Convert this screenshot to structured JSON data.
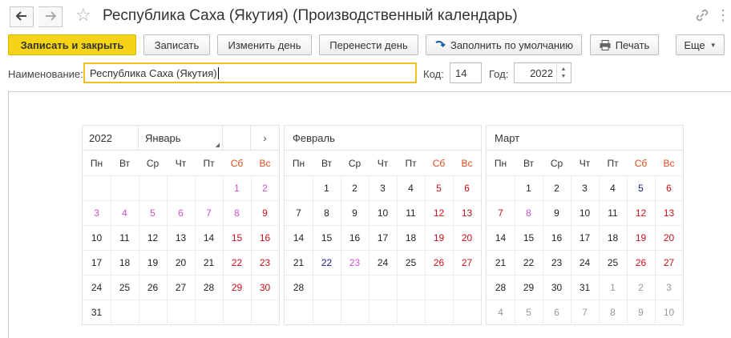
{
  "window": {
    "title": "Республика Саха (Якутия) (Производственный календарь)"
  },
  "toolbar": {
    "save_close": "Записать и закрыть",
    "save": "Записать",
    "change_day": "Изменить день",
    "move_day": "Перенести день",
    "fill_default": "Заполнить по умолчанию",
    "print": "Печать",
    "more": "Еще"
  },
  "form": {
    "name_label": "Наименование:",
    "name_value": "Республика Саха (Якутия)",
    "code_label": "Код:",
    "code_value": "14",
    "year_label": "Год:",
    "year_value": "2022"
  },
  "calendar": {
    "year": "2022",
    "weekdays": [
      "Пн",
      "Вт",
      "Ср",
      "Чт",
      "Пт",
      "Сб",
      "Вс"
    ],
    "months": [
      {
        "name": "Январь",
        "weeks": [
          [
            [
              "",
              ""
            ],
            [
              "",
              ""
            ],
            [
              "",
              ""
            ],
            [
              "",
              ""
            ],
            [
              "",
              ""
            ],
            [
              "1",
              "p"
            ],
            [
              "2",
              "p"
            ]
          ],
          [
            [
              "3",
              "p"
            ],
            [
              "4",
              "p"
            ],
            [
              "5",
              "p"
            ],
            [
              "6",
              "p"
            ],
            [
              "7",
              "p"
            ],
            [
              "8",
              "p"
            ],
            [
              "9",
              "r"
            ]
          ],
          [
            [
              "10",
              "k"
            ],
            [
              "11",
              "k"
            ],
            [
              "12",
              "k"
            ],
            [
              "13",
              "k"
            ],
            [
              "14",
              "k"
            ],
            [
              "15",
              "r"
            ],
            [
              "16",
              "r"
            ]
          ],
          [
            [
              "17",
              "k"
            ],
            [
              "18",
              "k"
            ],
            [
              "19",
              "k"
            ],
            [
              "20",
              "k"
            ],
            [
              "21",
              "k"
            ],
            [
              "22",
              "r"
            ],
            [
              "23",
              "r"
            ]
          ],
          [
            [
              "24",
              "k"
            ],
            [
              "25",
              "k"
            ],
            [
              "26",
              "k"
            ],
            [
              "27",
              "k"
            ],
            [
              "28",
              "k"
            ],
            [
              "29",
              "r"
            ],
            [
              "30",
              "r"
            ]
          ],
          [
            [
              "31",
              "k"
            ],
            [
              "",
              ""
            ],
            [
              "",
              ""
            ],
            [
              "",
              ""
            ],
            [
              "",
              ""
            ],
            [
              "",
              ""
            ],
            [
              "",
              ""
            ]
          ]
        ]
      },
      {
        "name": "Февраль",
        "weeks": [
          [
            [
              "",
              ""
            ],
            [
              "1",
              "k"
            ],
            [
              "2",
              "k"
            ],
            [
              "3",
              "k"
            ],
            [
              "4",
              "k"
            ],
            [
              "5",
              "r"
            ],
            [
              "6",
              "r"
            ]
          ],
          [
            [
              "7",
              "k"
            ],
            [
              "8",
              "k"
            ],
            [
              "9",
              "k"
            ],
            [
              "10",
              "k"
            ],
            [
              "11",
              "k"
            ],
            [
              "12",
              "r"
            ],
            [
              "13",
              "r"
            ]
          ],
          [
            [
              "14",
              "k"
            ],
            [
              "15",
              "k"
            ],
            [
              "16",
              "k"
            ],
            [
              "17",
              "k"
            ],
            [
              "18",
              "k"
            ],
            [
              "19",
              "r"
            ],
            [
              "20",
              "r"
            ]
          ],
          [
            [
              "21",
              "k"
            ],
            [
              "22",
              "b"
            ],
            [
              "23",
              "p"
            ],
            [
              "24",
              "k"
            ],
            [
              "25",
              "k"
            ],
            [
              "26",
              "r"
            ],
            [
              "27",
              "r"
            ]
          ],
          [
            [
              "28",
              "k"
            ],
            [
              "",
              ""
            ],
            [
              "",
              ""
            ],
            [
              "",
              ""
            ],
            [
              "",
              ""
            ],
            [
              "",
              ""
            ],
            [
              "",
              ""
            ]
          ],
          [
            [
              "",
              ""
            ],
            [
              "",
              ""
            ],
            [
              "",
              ""
            ],
            [
              "",
              ""
            ],
            [
              "",
              ""
            ],
            [
              "",
              ""
            ],
            [
              "",
              ""
            ]
          ]
        ]
      },
      {
        "name": "Март",
        "weeks": [
          [
            [
              "",
              ""
            ],
            [
              "1",
              "k"
            ],
            [
              "2",
              "k"
            ],
            [
              "3",
              "k"
            ],
            [
              "4",
              "k"
            ],
            [
              "5",
              "b"
            ],
            [
              "6",
              "r"
            ]
          ],
          [
            [
              "7",
              "r"
            ],
            [
              "8",
              "p"
            ],
            [
              "9",
              "k"
            ],
            [
              "10",
              "k"
            ],
            [
              "11",
              "k"
            ],
            [
              "12",
              "r"
            ],
            [
              "13",
              "r"
            ]
          ],
          [
            [
              "14",
              "k"
            ],
            [
              "15",
              "k"
            ],
            [
              "16",
              "k"
            ],
            [
              "17",
              "k"
            ],
            [
              "18",
              "k"
            ],
            [
              "19",
              "r"
            ],
            [
              "20",
              "r"
            ]
          ],
          [
            [
              "21",
              "k"
            ],
            [
              "22",
              "k"
            ],
            [
              "23",
              "k"
            ],
            [
              "24",
              "k"
            ],
            [
              "25",
              "k"
            ],
            [
              "26",
              "r"
            ],
            [
              "27",
              "r"
            ]
          ],
          [
            [
              "28",
              "k"
            ],
            [
              "29",
              "k"
            ],
            [
              "30",
              "k"
            ],
            [
              "31",
              "k"
            ],
            [
              "1",
              "g"
            ],
            [
              "2",
              "g"
            ],
            [
              "3",
              "g"
            ]
          ],
          [
            [
              "4",
              "g"
            ],
            [
              "5",
              "g"
            ],
            [
              "6",
              "g"
            ],
            [
              "7",
              "g"
            ],
            [
              "8",
              "g"
            ],
            [
              "9",
              "g"
            ],
            [
              "10",
              "g"
            ]
          ]
        ]
      }
    ]
  },
  "colors": {
    "k": "#222222",
    "r": "#c8101a",
    "p": "#d24fd2",
    "b": "#1a237e",
    "g": "#999999",
    "weekend_header": "#e24a1c",
    "accent": "#f5d415"
  }
}
